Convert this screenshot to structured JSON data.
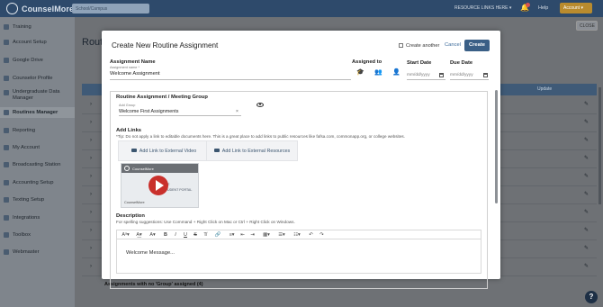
{
  "topbar": {
    "brand": "CounselMore",
    "search_placeholder": "School/Campus",
    "resource_links": "RESOURCE LINKS HERE ▾",
    "help": "Help",
    "user": "Account ▾"
  },
  "sidebar": {
    "items": [
      {
        "label": "Training"
      },
      {
        "label": "Account Setup"
      },
      {
        "label": "Google Drive"
      },
      {
        "label": "Counselor Profile"
      },
      {
        "label": "Undergraduate Data Manager"
      },
      {
        "label": "Routines Manager"
      },
      {
        "label": "Reporting"
      },
      {
        "label": "My Account"
      },
      {
        "label": "Broadcasting Station"
      },
      {
        "label": "Accounting Setup"
      },
      {
        "label": "Texting Setup"
      },
      {
        "label": "Integrations"
      },
      {
        "label": "Toolbox"
      },
      {
        "label": "Webmaster"
      }
    ]
  },
  "background": {
    "page_title": "Routi",
    "close_label": "CLOSE",
    "header_col_right": "Update",
    "bottom_text": "Assignments with no 'Group' assigned (4)",
    "help_icon": "?"
  },
  "modal": {
    "title": "Create New Routine Assignment",
    "create_another": "Create another",
    "cancel": "Cancel",
    "create": "Create",
    "assignment_name_label": "Assignment Name",
    "assignment_name_sublabel": "Assignment name *",
    "assignment_name_value": "Welcome Assignment",
    "assigned_to_label": "Assigned to",
    "start_date_label": "Start Date",
    "due_date_label": "Due Date",
    "date_placeholder": "mm/dd/yyyy",
    "group_label": "Routine Assignment / Meeting Group",
    "group_sublabel": "Add Group",
    "group_value": "Welcome First Assignments",
    "group_clear": "×",
    "add_links_label": "Add Links",
    "add_links_tip": "*Tip: Do not apply a link to editable documents here. This is a great place to add links to public resources like fafsa.com, commonapp.org, or college websites.",
    "link_video": "Add Link to External Video",
    "link_resources": "Add Link to External Resources",
    "video": {
      "channel": "CounselMore",
      "line1": "WELCOME",
      "line2": "YOUR STUDENT PORTAL",
      "footer": "CounselMore"
    },
    "description_label": "Description",
    "description_tip": "For spelling suggestions: Use Command + Right Click on Mac or Ctrl + Right Click on Windows.",
    "toolbar": [
      "Aᵃ▾",
      "A͟▾",
      "A▾",
      "B",
      "I",
      "U",
      "S",
      "T̸",
      "🔗",
      "≡▾",
      "⇤",
      "⇥",
      "▦▾",
      "☰▾",
      "☷▾",
      "↶",
      "↷"
    ],
    "editor_text": "Welcome Message..."
  }
}
